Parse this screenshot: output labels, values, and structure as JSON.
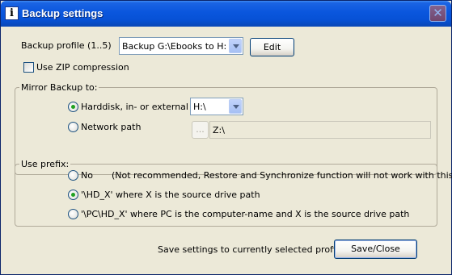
{
  "window": {
    "title": "Backup settings",
    "title_icon": "i",
    "close_glyph": "✕"
  },
  "profile": {
    "label": "Backup profile (1..5)",
    "selected": "Backup G:\\Ebooks to H:",
    "edit_label": "Edit"
  },
  "zip": {
    "label": "Use ZIP compression",
    "checked": false
  },
  "mirror": {
    "legend": "Mirror Backup to:",
    "harddisk_label": "Harddisk, in- or external",
    "harddisk_selected": true,
    "drive_selected": "H:\\",
    "network_label": "Network path",
    "network_selected": false,
    "browse_label": "...",
    "network_path_value": "Z:\\"
  },
  "prefix": {
    "legend": "Use prefix:",
    "options": [
      {
        "label": "No",
        "note": "(Not recommended, Restore and Synchronize function will not work with this) !",
        "selected": false
      },
      {
        "label": "'\\HD_X' where X is the source drive path",
        "selected": true
      },
      {
        "label": "'\\PC\\HD_X' where PC is the computer-name and X is the source drive path",
        "selected": false
      }
    ]
  },
  "footer": {
    "hint": "Save settings to currently selected profile",
    "save_label": "Save/Close"
  },
  "colors": {
    "title_bar": "#0a56dd",
    "window_bg": "#ece9d8",
    "radio_dot": "#21a121"
  }
}
